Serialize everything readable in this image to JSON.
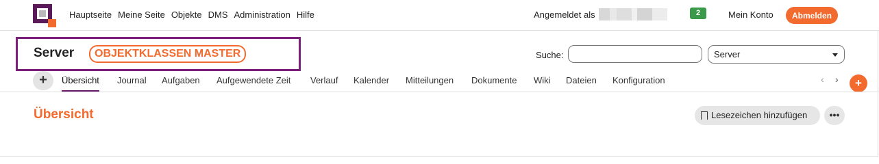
{
  "topbar": {
    "nav": [
      "Hauptseite",
      "Meine Seite",
      "Objekte",
      "DMS",
      "Administration",
      "Hilfe"
    ],
    "logged_in_as": "Angemeldet als",
    "badge_count": "2",
    "my_account": "Mein Konto",
    "logout": "Abmelden"
  },
  "project": {
    "title": "Server",
    "class_badge": "OBJEKTKLASSEN MASTER",
    "search_label": "Suche:",
    "search_value": "",
    "search_scope": "Server"
  },
  "tabs": [
    "Übersicht",
    "Journal",
    "Aufgaben",
    "Aufgewendete Zeit",
    "Verlauf",
    "Kalender",
    "Mitteilungen",
    "Dokumente",
    "Wiki",
    "Dateien",
    "Konfiguration"
  ],
  "content": {
    "heading": "Übersicht",
    "bookmark_label": "Lesezeichen hinzufügen",
    "more_label": "•••"
  },
  "colors": {
    "accent": "#f26a2d",
    "brand": "#6a1a6a",
    "badge": "#3a9a4a"
  }
}
